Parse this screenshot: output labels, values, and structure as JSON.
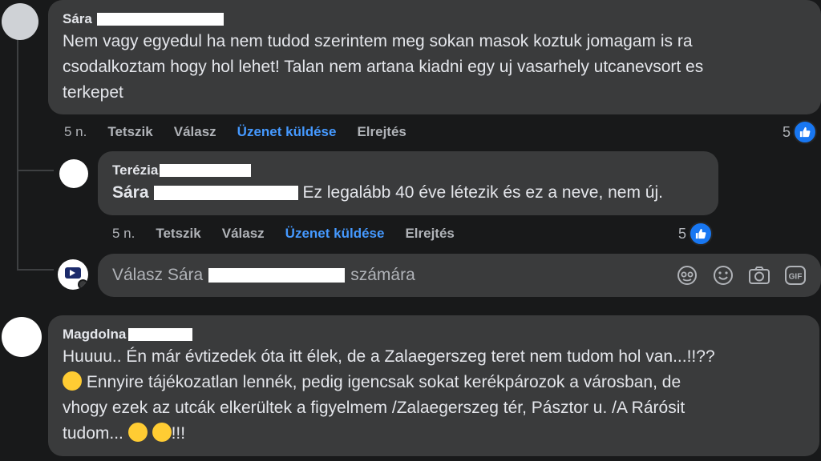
{
  "comments": [
    {
      "author": "Sára",
      "lines": [
        "Nem vagy egyedul ha nem tudod szerintem meg sokan masok koztuk jomagam is ra",
        "csodalkoztam hogy hol lehet! Talan nem artana kiadni egy uj vasarhely utcanevsort es",
        "terkepet"
      ],
      "actions": {
        "time": "5 n.",
        "like": "Tetszik",
        "reply": "Válasz",
        "message": "Üzenet küldése",
        "hide": "Elrejtés"
      },
      "reactions": "5"
    }
  ],
  "reply": {
    "author": "Terézia",
    "mention": "Sára",
    "text": "Ez legalább 40 éve létezik és ez a neve, nem új.",
    "actions": {
      "time": "5 n.",
      "like": "Tetszik",
      "reply": "Válasz",
      "message": "Üzenet küldése",
      "hide": "Elrejtés"
    },
    "reactions": "5"
  },
  "reply_box": {
    "prefix": "Válasz Sára",
    "suffix": "számára",
    "icons": [
      "avatar-sticker-icon",
      "emoji-icon",
      "camera-icon",
      "gif-icon"
    ],
    "gif_label": "GIF"
  },
  "comment2": {
    "author": "Magdolna",
    "line1": "Huuuu.. Én már évtizedek óta itt élek, de a Zalaegerszeg teret nem tudom hol van...!!??",
    "line2": "Ennyire tájékozatlan lennék, pedig igencsak sokat kerékpározok a városban, de",
    "line3": "vhogy ezek az utcák elkerültek a figyelmem /Zalaegerszeg tér, Pásztor u. /A Rárósit",
    "line4_text": "tudom...",
    "line4_end": "!!!"
  },
  "colors": {
    "background": "#18191a",
    "bubble": "#3a3b3c",
    "link": "#4599ff",
    "like": "#1877f2"
  }
}
